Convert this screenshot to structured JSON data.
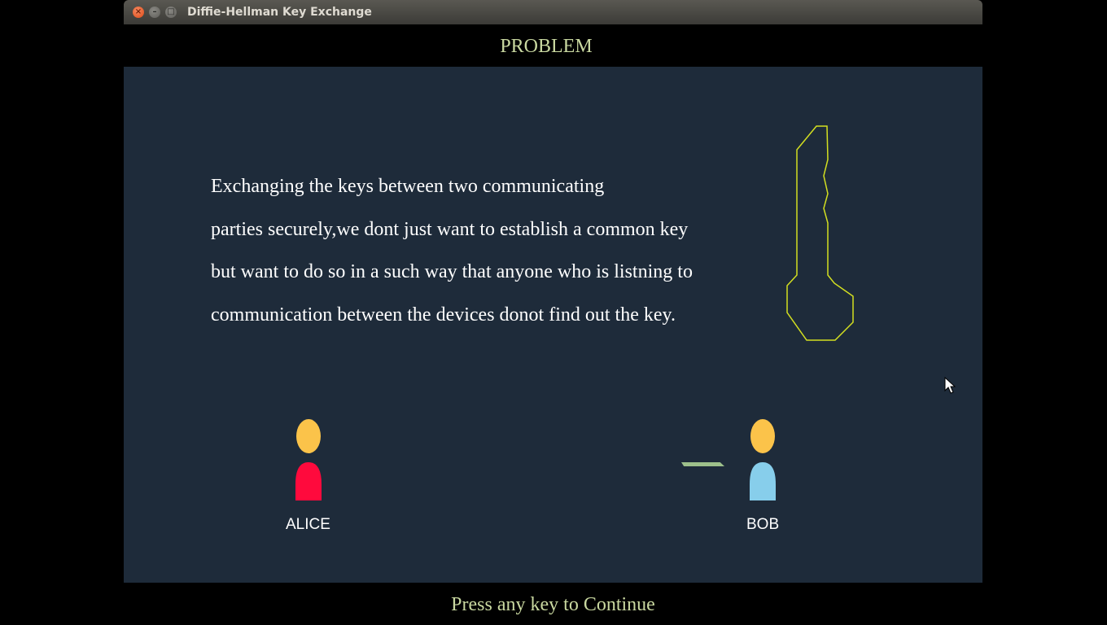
{
  "window": {
    "title": "Diffie-Hellman Key Exchange",
    "close_glyph": "×",
    "minimize_glyph": "–",
    "maximize_glyph": "□"
  },
  "header": {
    "title": "PROBLEM"
  },
  "paragraph": {
    "lines": [
      "Exchanging the keys between two communicating",
      "parties securely,we dont just want to establish a common key",
      "but want to do so in a such way that anyone who is listning to",
      "communication between the devices donot find out the key."
    ]
  },
  "people": {
    "alice": {
      "label": "ALICE",
      "head_color": "#fbc34a",
      "body_color": "#ff0a3d"
    },
    "bob": {
      "label": "BOB",
      "head_color": "#fbc34a",
      "body_color": "#87ceeb"
    }
  },
  "key_icon": {
    "color": "#d4e020"
  },
  "transfer_bar": {
    "color": "#9dc08b"
  },
  "footer": {
    "prompt": "Press any key to Continue"
  },
  "colors": {
    "canvas_bg": "#1e2b3a",
    "text_accent": "#c9d8a0"
  }
}
